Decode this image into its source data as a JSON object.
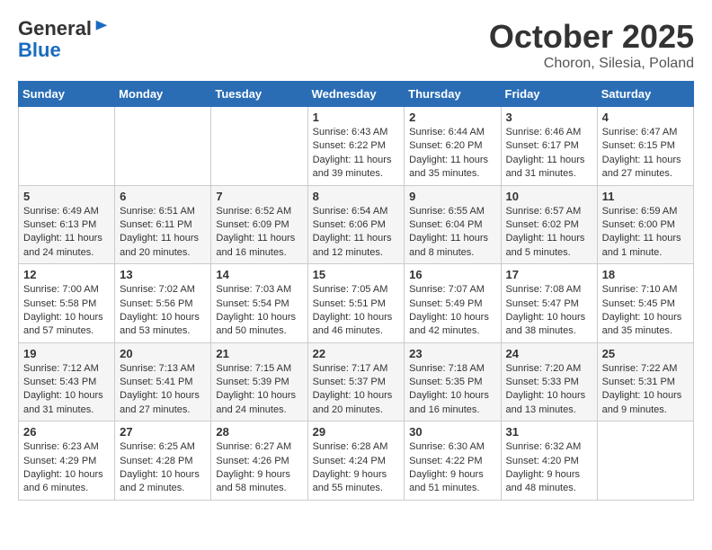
{
  "logo": {
    "general": "General",
    "blue": "Blue"
  },
  "title": "October 2025",
  "location": "Choron, Silesia, Poland",
  "days_header": [
    "Sunday",
    "Monday",
    "Tuesday",
    "Wednesday",
    "Thursday",
    "Friday",
    "Saturday"
  ],
  "weeks": [
    [
      {
        "day": "",
        "info": ""
      },
      {
        "day": "",
        "info": ""
      },
      {
        "day": "",
        "info": ""
      },
      {
        "day": "1",
        "info": "Sunrise: 6:43 AM\nSunset: 6:22 PM\nDaylight: 11 hours\nand 39 minutes."
      },
      {
        "day": "2",
        "info": "Sunrise: 6:44 AM\nSunset: 6:20 PM\nDaylight: 11 hours\nand 35 minutes."
      },
      {
        "day": "3",
        "info": "Sunrise: 6:46 AM\nSunset: 6:17 PM\nDaylight: 11 hours\nand 31 minutes."
      },
      {
        "day": "4",
        "info": "Sunrise: 6:47 AM\nSunset: 6:15 PM\nDaylight: 11 hours\nand 27 minutes."
      }
    ],
    [
      {
        "day": "5",
        "info": "Sunrise: 6:49 AM\nSunset: 6:13 PM\nDaylight: 11 hours\nand 24 minutes."
      },
      {
        "day": "6",
        "info": "Sunrise: 6:51 AM\nSunset: 6:11 PM\nDaylight: 11 hours\nand 20 minutes."
      },
      {
        "day": "7",
        "info": "Sunrise: 6:52 AM\nSunset: 6:09 PM\nDaylight: 11 hours\nand 16 minutes."
      },
      {
        "day": "8",
        "info": "Sunrise: 6:54 AM\nSunset: 6:06 PM\nDaylight: 11 hours\nand 12 minutes."
      },
      {
        "day": "9",
        "info": "Sunrise: 6:55 AM\nSunset: 6:04 PM\nDaylight: 11 hours\nand 8 minutes."
      },
      {
        "day": "10",
        "info": "Sunrise: 6:57 AM\nSunset: 6:02 PM\nDaylight: 11 hours\nand 5 minutes."
      },
      {
        "day": "11",
        "info": "Sunrise: 6:59 AM\nSunset: 6:00 PM\nDaylight: 11 hours\nand 1 minute."
      }
    ],
    [
      {
        "day": "12",
        "info": "Sunrise: 7:00 AM\nSunset: 5:58 PM\nDaylight: 10 hours\nand 57 minutes."
      },
      {
        "day": "13",
        "info": "Sunrise: 7:02 AM\nSunset: 5:56 PM\nDaylight: 10 hours\nand 53 minutes."
      },
      {
        "day": "14",
        "info": "Sunrise: 7:03 AM\nSunset: 5:54 PM\nDaylight: 10 hours\nand 50 minutes."
      },
      {
        "day": "15",
        "info": "Sunrise: 7:05 AM\nSunset: 5:51 PM\nDaylight: 10 hours\nand 46 minutes."
      },
      {
        "day": "16",
        "info": "Sunrise: 7:07 AM\nSunset: 5:49 PM\nDaylight: 10 hours\nand 42 minutes."
      },
      {
        "day": "17",
        "info": "Sunrise: 7:08 AM\nSunset: 5:47 PM\nDaylight: 10 hours\nand 38 minutes."
      },
      {
        "day": "18",
        "info": "Sunrise: 7:10 AM\nSunset: 5:45 PM\nDaylight: 10 hours\nand 35 minutes."
      }
    ],
    [
      {
        "day": "19",
        "info": "Sunrise: 7:12 AM\nSunset: 5:43 PM\nDaylight: 10 hours\nand 31 minutes."
      },
      {
        "day": "20",
        "info": "Sunrise: 7:13 AM\nSunset: 5:41 PM\nDaylight: 10 hours\nand 27 minutes."
      },
      {
        "day": "21",
        "info": "Sunrise: 7:15 AM\nSunset: 5:39 PM\nDaylight: 10 hours\nand 24 minutes."
      },
      {
        "day": "22",
        "info": "Sunrise: 7:17 AM\nSunset: 5:37 PM\nDaylight: 10 hours\nand 20 minutes."
      },
      {
        "day": "23",
        "info": "Sunrise: 7:18 AM\nSunset: 5:35 PM\nDaylight: 10 hours\nand 16 minutes."
      },
      {
        "day": "24",
        "info": "Sunrise: 7:20 AM\nSunset: 5:33 PM\nDaylight: 10 hours\nand 13 minutes."
      },
      {
        "day": "25",
        "info": "Sunrise: 7:22 AM\nSunset: 5:31 PM\nDaylight: 10 hours\nand 9 minutes."
      }
    ],
    [
      {
        "day": "26",
        "info": "Sunrise: 6:23 AM\nSunset: 4:29 PM\nDaylight: 10 hours\nand 6 minutes."
      },
      {
        "day": "27",
        "info": "Sunrise: 6:25 AM\nSunset: 4:28 PM\nDaylight: 10 hours\nand 2 minutes."
      },
      {
        "day": "28",
        "info": "Sunrise: 6:27 AM\nSunset: 4:26 PM\nDaylight: 9 hours\nand 58 minutes."
      },
      {
        "day": "29",
        "info": "Sunrise: 6:28 AM\nSunset: 4:24 PM\nDaylight: 9 hours\nand 55 minutes."
      },
      {
        "day": "30",
        "info": "Sunrise: 6:30 AM\nSunset: 4:22 PM\nDaylight: 9 hours\nand 51 minutes."
      },
      {
        "day": "31",
        "info": "Sunrise: 6:32 AM\nSunset: 4:20 PM\nDaylight: 9 hours\nand 48 minutes."
      },
      {
        "day": "",
        "info": ""
      }
    ]
  ]
}
